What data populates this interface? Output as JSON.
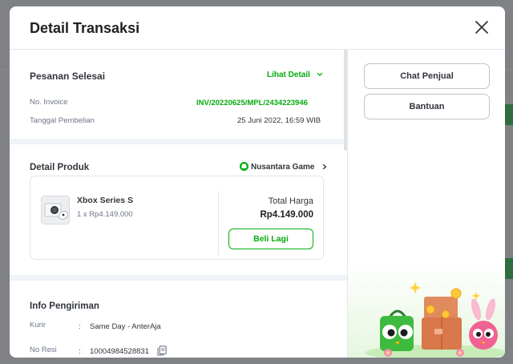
{
  "modal": {
    "title": "Detail Transaksi"
  },
  "order": {
    "status": "Pesanan Selesai",
    "detail_link": "Lihat Detail",
    "invoice_label": "No. Invoice",
    "invoice_value": "INV/20220625/MPL/2434223946",
    "date_label": "Tanggal Pembelian",
    "date_value": "25 Juni 2022, 16:59 WIB"
  },
  "product": {
    "section_title": "Detail Produk",
    "store_name": "Nusantara Game",
    "name": "Xbox Series S",
    "qty_price": "1 x Rp4.149.000",
    "total_label": "Total Harga",
    "total_value": "Rp4.149.000",
    "buy_again": "Beli Lagi"
  },
  "shipping": {
    "section_title": "Info Pengiriman",
    "courier_label": "Kurir",
    "courier_value": "Same Day - AnterAja",
    "resi_label": "No Resi",
    "resi_value": "10004984528831",
    "colon": ":"
  },
  "actions": {
    "chat_seller": "Chat Penjual",
    "help": "Bantuan"
  },
  "colors": {
    "accent_green": "#03ac0e",
    "text": "#31353b",
    "muted": "#6d7588"
  }
}
